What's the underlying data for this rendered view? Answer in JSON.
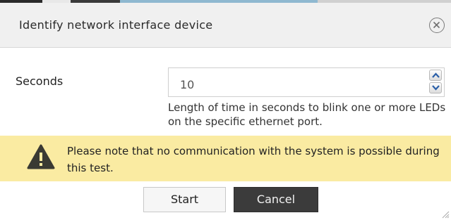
{
  "dialog": {
    "title": "Identify network interface device",
    "close_icon": "close-icon"
  },
  "form": {
    "seconds": {
      "label": "Seconds",
      "value": "10",
      "help": "Length of time in seconds to blink one or more LEDs on the specific ethernet port."
    }
  },
  "warning": {
    "icon": "warning-icon",
    "text": "Please note that no communication with the system is possible during this test.",
    "color": "#faeba2"
  },
  "buttons": {
    "start_label": "Start",
    "cancel_label": "Cancel"
  }
}
